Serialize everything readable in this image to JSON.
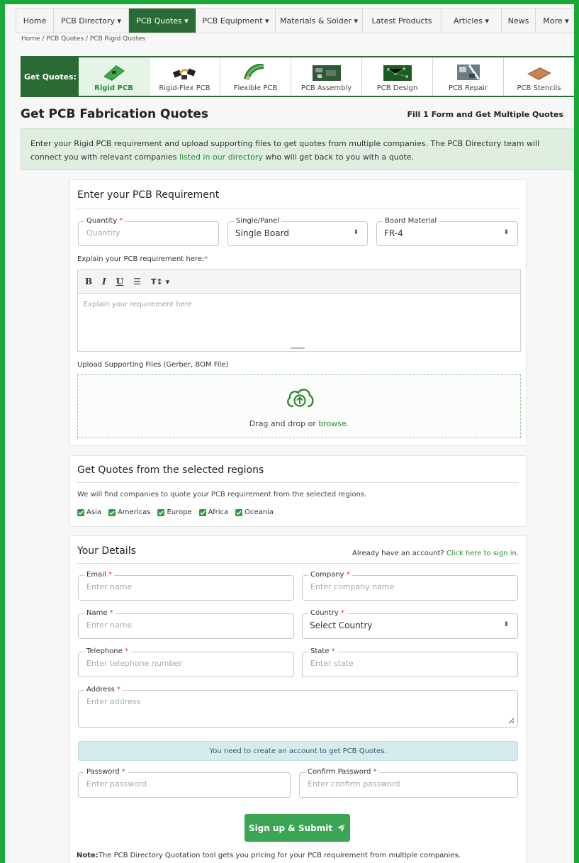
{
  "nav": {
    "items": [
      {
        "label": "Home"
      },
      {
        "label": "PCB Directory ▾"
      },
      {
        "label": "PCB Quotes ▾"
      },
      {
        "label": "PCB Equipment ▾"
      },
      {
        "label": "Materials & Solder ▾"
      },
      {
        "label": "Latest Products"
      },
      {
        "label": "Articles ▾"
      },
      {
        "label": "News"
      },
      {
        "label": "More ▾"
      }
    ],
    "active_index": 2,
    "accent": "#2a6a34"
  },
  "breadcrumb": "Home  /  PCB Quotes / PCB Rigid Quotes",
  "quote_types": {
    "label": "Get Quotes:",
    "items": [
      {
        "label": "Rigid PCB",
        "icon": "rigid-pcb-icon"
      },
      {
        "label": "Rigid-Flex PCB",
        "icon": "rigid-flex-pcb-icon"
      },
      {
        "label": "Flexible PCB",
        "icon": "flexible-pcb-icon"
      },
      {
        "label": "PCB Assembly",
        "icon": "pcb-assembly-icon"
      },
      {
        "label": "PCB Design",
        "icon": "pcb-design-icon"
      },
      {
        "label": "PCB Repair",
        "icon": "pcb-repair-icon"
      },
      {
        "label": "PCB Stencils",
        "icon": "pcb-stencils-icon"
      }
    ],
    "active_index": 0
  },
  "header": {
    "title": "Get PCB Fabrication Quotes",
    "tagline": "Fill 1 Form and Get Multiple Quotes"
  },
  "intro": {
    "text_before": "Enter your Rigid PCB requirement and upload supporting files to get quotes from multiple companies. The PCB Directory team will connect you with relevant companies ",
    "link": "listed in our directory",
    "text_after": " who will get back to you with a quote."
  },
  "requirement": {
    "title": "Enter your PCB Requirement",
    "quantity": {
      "label": "Quantity",
      "placeholder": "Quantity"
    },
    "single_panel": {
      "label": "Single/Panel",
      "value": "Single Board"
    },
    "board_material": {
      "label": "Board Material",
      "value": "FR-4"
    },
    "explain_label": "Explain your PCB requirement here:",
    "editor": {
      "bold": "B",
      "italic": "I",
      "underline": "U",
      "list": "☰",
      "size": "T↕ ▾",
      "placeholder": "Explain your requirement here"
    },
    "upload_label": "Upload Supporting Files (Gerber, BOM File)",
    "dropzone_text": "Drag and drop or ",
    "dropzone_link": "browse."
  },
  "regions": {
    "title": "Get Quotes from the selected regions",
    "text": "We will find companies to quote your PCB requirement from the selected regions.",
    "items": [
      {
        "label": "Asia",
        "checked": true
      },
      {
        "label": "Americas",
        "checked": true
      },
      {
        "label": "Europe",
        "checked": true
      },
      {
        "label": "Africa",
        "checked": true
      },
      {
        "label": "Oceania",
        "checked": true
      }
    ]
  },
  "details": {
    "title": "Your Details",
    "signin_text": "Already have an account? ",
    "signin_link": "Click here to sign in.",
    "email": {
      "label": "Email",
      "placeholder": "Enter name"
    },
    "company": {
      "label": "Company",
      "placeholder": "Enter company name"
    },
    "name": {
      "label": "Name",
      "placeholder": "Enter name"
    },
    "country": {
      "label": "Country",
      "value": "Select Country"
    },
    "telephone": {
      "label": "Telephone",
      "placeholder": "Enter telephone number"
    },
    "state": {
      "label": "State",
      "placeholder": "Enter state"
    },
    "address": {
      "label": "Address",
      "placeholder": "Enter address"
    },
    "account_notice": "You need to create an account to get PCB Quotes.",
    "password": {
      "label": "Password",
      "placeholder": "Enter password"
    },
    "confirm_password": {
      "label": "Confirm Password",
      "placeholder": "Enter confirm password"
    }
  },
  "submit_label": "Sign up & Submit",
  "note": {
    "prefix": "Note:",
    "text": "The PCB Directory Quotation tool gets you pricing for your PCB requirement from multiple companies."
  },
  "colors": {
    "primary_green": "#2a6a34",
    "button_green": "#3aa655",
    "frame_green": "#1aa838",
    "link_green": "#2a8a35"
  }
}
